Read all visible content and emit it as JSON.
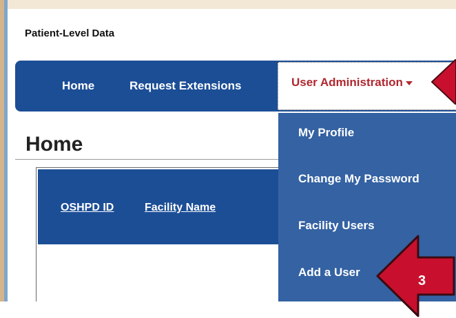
{
  "app": {
    "title": "Patient-Level Data"
  },
  "nav": {
    "home": "Home",
    "request_extensions": "Request Extensions",
    "user_admin": "User Administration"
  },
  "page": {
    "title": "Home"
  },
  "table": {
    "columns": [
      "OSHPD ID",
      "Facility Name"
    ]
  },
  "dropdown": {
    "items": [
      "My Profile",
      "Change My Password",
      "Facility Users",
      "Add a User"
    ]
  },
  "callout": {
    "step_label": "3"
  },
  "colors": {
    "nav_blue": "#1c4e96",
    "dropdown_blue": "#3462a3",
    "accent_red": "#b0272f",
    "arrow_red": "#c8102e"
  },
  "icons": {
    "caret": "caret-down-icon",
    "arrow": "callout-arrow"
  }
}
